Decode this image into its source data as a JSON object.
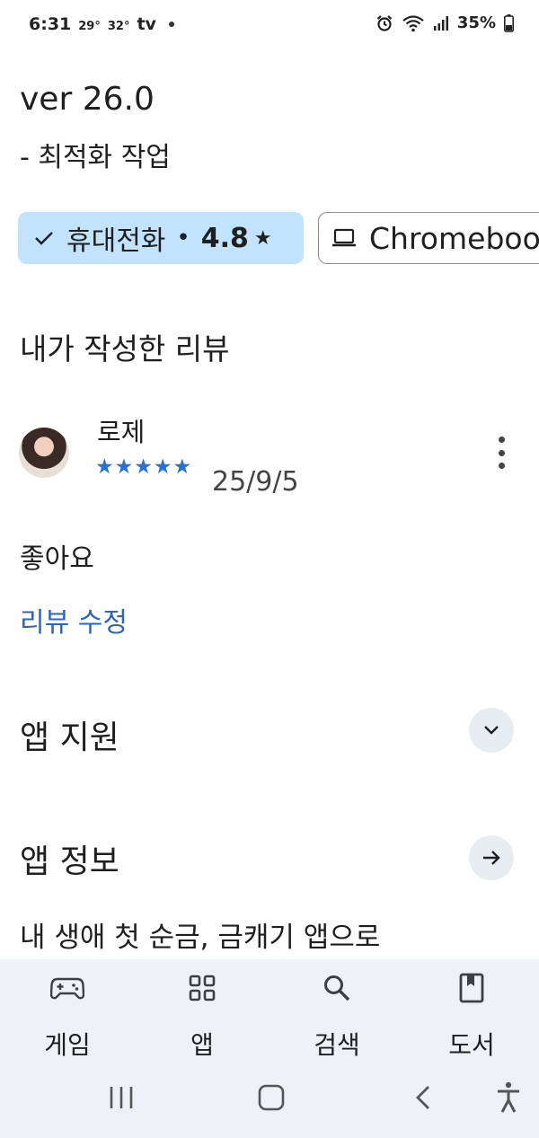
{
  "status_bar": {
    "time": "6:31",
    "weather_now": "29°",
    "weather_high": "32°",
    "tv_label": "tv",
    "battery": "35%"
  },
  "whats_new": {
    "version": "ver 26.0",
    "notes": "- 최적화 작업"
  },
  "device_chips": [
    {
      "label": "휴대전화",
      "rating": "4.8",
      "selected": true,
      "icon": "check-icon"
    },
    {
      "label": "Chromebook",
      "selected": false,
      "icon": "laptop-icon"
    }
  ],
  "my_review": {
    "section_title": "내가 작성한 리뷰",
    "reviewer_name": "로제",
    "star_rating": 5,
    "date": "25/9/5",
    "text": "좋아요",
    "edit_label": "리뷰 수정",
    "more_icon": "more-vert-icon"
  },
  "app_support": {
    "title": "앱 지원",
    "icon": "chevron-down-icon"
  },
  "app_info": {
    "title": "앱 정보",
    "icon": "arrow-right-icon",
    "description_preview": "내 생애 첫 순금, 금캐기 앱으로"
  },
  "bottom_nav": [
    {
      "label": "게임",
      "icon": "gamepad-icon"
    },
    {
      "label": "앱",
      "icon": "apps-grid-icon"
    },
    {
      "label": "검색",
      "icon": "search-icon"
    },
    {
      "label": "도서",
      "icon": "book-icon"
    }
  ],
  "colors": {
    "chip_selected_bg": "#c2e3fd",
    "star_blue": "#2a6fd6",
    "link_blue": "#2a64c6",
    "bottom_nav_bg": "#eef2f6"
  }
}
